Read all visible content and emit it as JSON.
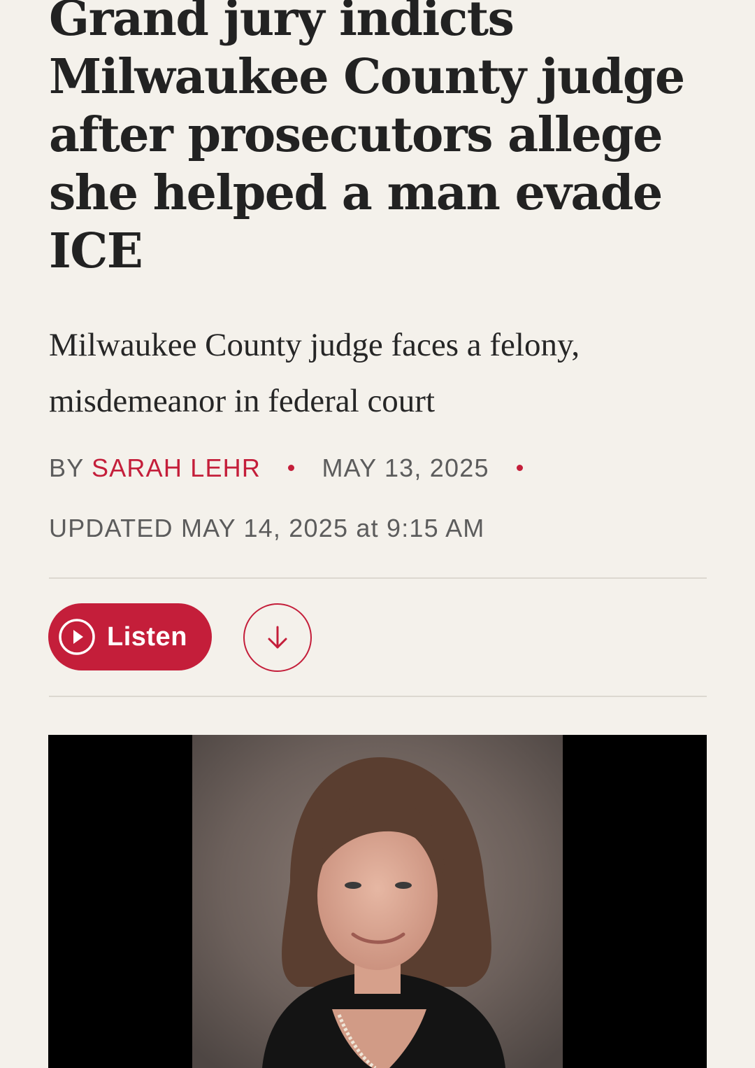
{
  "article": {
    "headline": "Grand jury indicts Milwaukee County judge after prosecutors allege she helped a man evade ICE",
    "dek": "Milwaukee County judge faces a felony, misdemeanor in federal court",
    "byline_prefix": "BY",
    "author": "SARAH LEHR",
    "published": "MAY 13, 2025",
    "updated": "UPDATED MAY 14, 2025 at 9:15 AM"
  },
  "actions": {
    "listen_label": "Listen",
    "listen_icon": "play-circle-icon",
    "download_icon": "arrow-down-icon"
  },
  "photo": {
    "subject": "portrait photo"
  },
  "colors": {
    "accent": "#c41e3a",
    "background": "#f4f1eb",
    "text": "#222222",
    "meta": "#5c5c5c"
  }
}
